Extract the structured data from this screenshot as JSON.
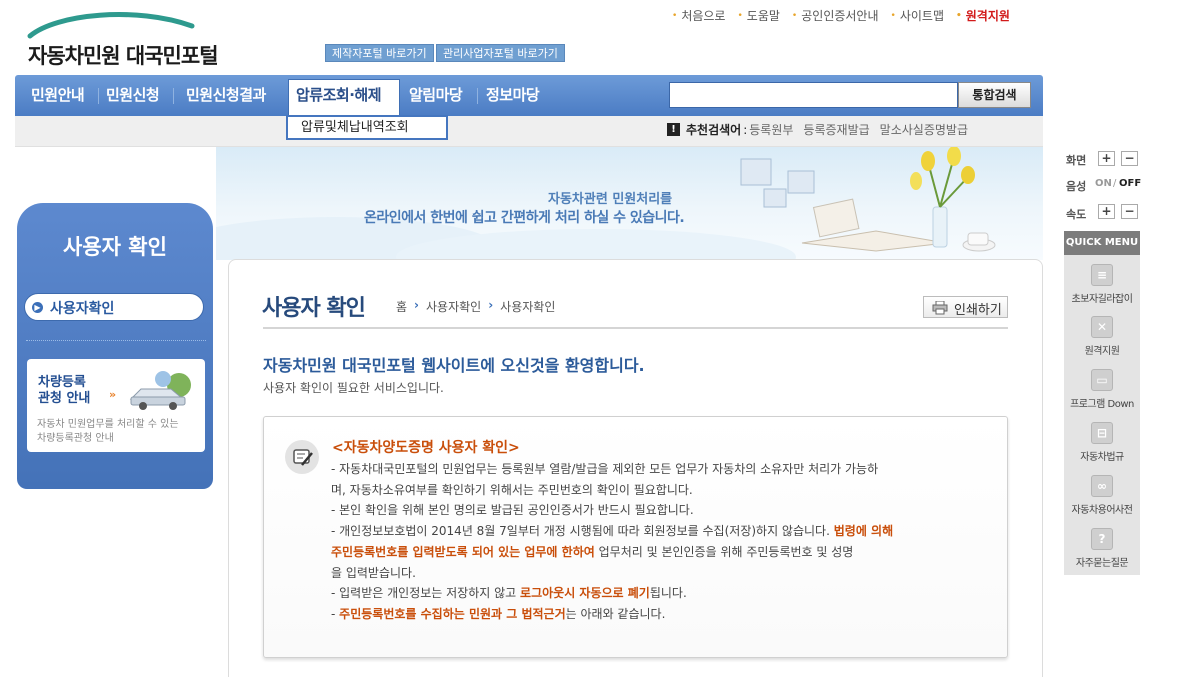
{
  "header": {
    "logo_text": "자동차민원 대국민포털",
    "portal_buttons": [
      "제작자포털 바로가기",
      "관리사업자포털 바로가기"
    ],
    "top_links": [
      "처음으로",
      "도움말",
      "공인인증서안내",
      "사이트맵",
      "원격지원"
    ]
  },
  "gnb": {
    "items": [
      "민원안내",
      "민원신청",
      "민원신청결과",
      "압류조회·해제",
      "알림마당",
      "정보마당"
    ],
    "search_placeholder": "",
    "search_button": "통합검색",
    "submenu_item": "압류및체납내역조회"
  },
  "recommend": {
    "title": "추천검색어",
    "separator": ":",
    "keywords": [
      "등록원부",
      "등록증재발급",
      "말소사실증명발급"
    ]
  },
  "banner": {
    "line1": "자동차관련 민원처리를",
    "line2": "온라인에서 한번에 쉽고 간편하게 처리 하실 수 있습니다."
  },
  "lnb": {
    "title": "사용자 확인",
    "item": "사용자확인",
    "box_title_1": "차량등록",
    "box_title_2": "관청 안내",
    "box_desc_1": "자동차 민원업무를 처리할 수 있는",
    "box_desc_2": "차량등록관청 안내"
  },
  "content": {
    "title": "사용자 확인",
    "breadcrumb": [
      "홈",
      "사용자확인",
      "사용자확인"
    ],
    "print_label": "인쇄하기",
    "welcome": "자동차민원 대국민포털 웹사이트에 오신것을 환영합니다.",
    "welcome_sub": "사용자 확인이 필요한 서비스입니다.",
    "notice_title": "<자동차양도증명 사용자 확인>",
    "notice": {
      "l1": "- 자동차대국민포털의 민원업무는 등록원부 열람/발급을 제외한 모든 업무가 자동차의 소유자만 처리가 가능하",
      "l2": "며, 자동차소유여부를 확인하기 위해서는 주민번호의 확인이 필요합니다.",
      "l3": "- 본인 확인을 위해 본인 명의로 발급된 공인인증서가 반드시 필요합니다.",
      "l4a": "- 개인정보보호법이 2014년 8월 7일부터 개정 시행됨에 따라 회원정보를 수집(저장)하지 않습니다.",
      "l4b": "법령에 의해",
      "l5a": "주민등록번호를 입력받도록 되어 있는 업무에 한하여",
      "l5b": "업무처리 및 본인인증을 위해 주민등록번호 및 성명",
      "l6": "을 입력받습니다.",
      "l7a": "- 입력받은 개인정보는 저장하지 않고",
      "l7b": "로그아웃시 자동으로 폐기",
      "l7c": "됩니다.",
      "l8a": "- ",
      "l8b": "주민등록번호를 수집하는 민원과 그 법적근거",
      "l8c": "는 아래와 같습니다."
    }
  },
  "quick": {
    "screen_label": "화면",
    "voice_label": "음성",
    "voice_on": "ON",
    "voice_sep": "/",
    "voice_off": "OFF",
    "speed_label": "속도",
    "plus": "+",
    "minus": "−",
    "menu_title": "QUICK MENU",
    "items": [
      "초보자길라잡이",
      "원격지원",
      "프로그램 Down",
      "자동차법규",
      "자동차용어사전",
      "자주묻는질문"
    ]
  },
  "colors": {
    "gnb": "#4b7cc4",
    "title": "#274a7c",
    "highlight": "#c94e0a",
    "remote_support": "#d21a1a"
  }
}
